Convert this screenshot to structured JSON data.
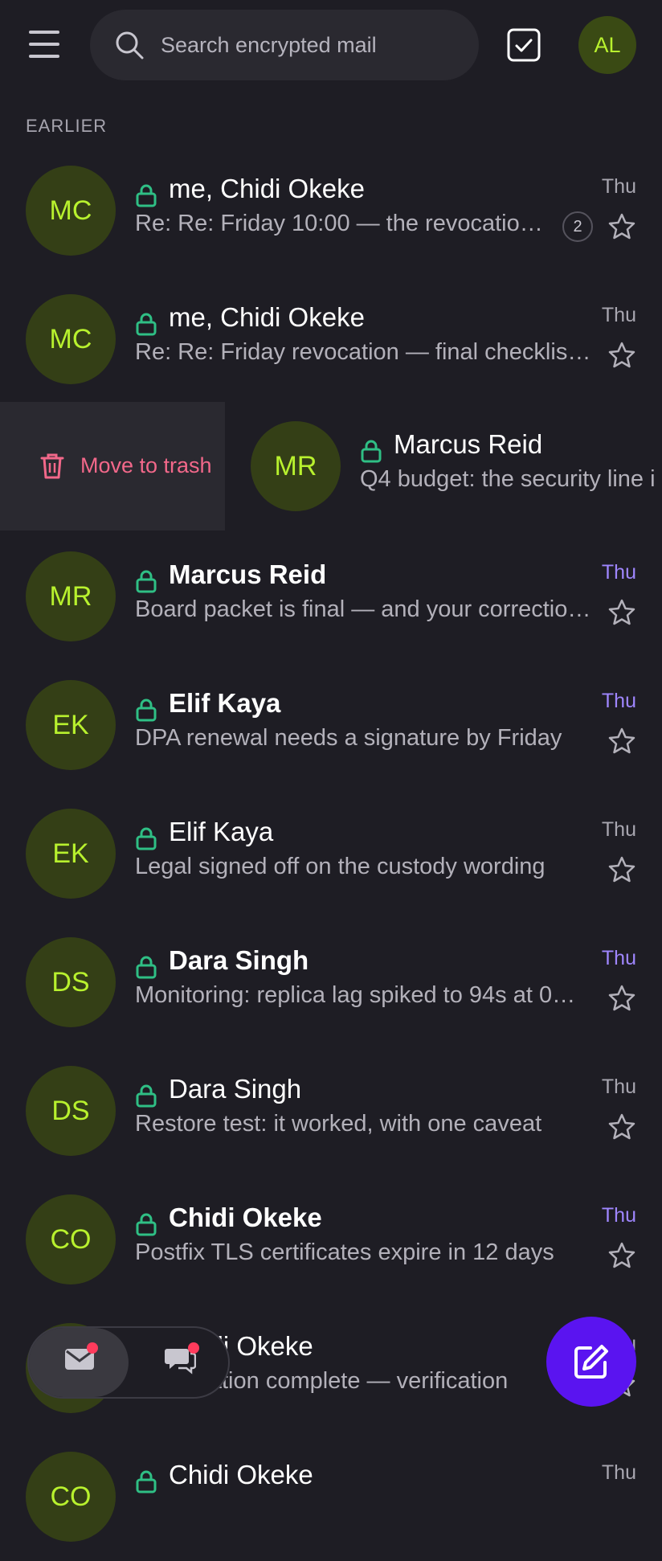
{
  "header": {
    "search_placeholder": "Search encrypted mail",
    "user_initials": "AL"
  },
  "section_label": "EARLIER",
  "swipe_action": {
    "label": "Move to trash"
  },
  "swiped_row": {
    "initials": "MR",
    "sender": "Marcus Reid",
    "preview": "Q4 budget: the security line i"
  },
  "rows": [
    {
      "initials": "MC",
      "sender": "me, Chidi Okeke",
      "preview": "Re: Re: Friday 10:00 — the revocation …",
      "date": "Thu",
      "unread": false,
      "count": "2"
    },
    {
      "initials": "MC",
      "sender": "me, Chidi Okeke",
      "preview": "Re: Re: Friday revocation — final checklist…",
      "date": "Thu",
      "unread": false
    },
    {
      "initials": "MR",
      "sender": "Marcus Reid",
      "preview": "Board packet is final — and your correctio…",
      "date": "Thu",
      "unread": true
    },
    {
      "initials": "EK",
      "sender": "Elif Kaya",
      "preview": "DPA renewal needs a signature by Friday",
      "date": "Thu",
      "unread": true
    },
    {
      "initials": "EK",
      "sender": "Elif Kaya",
      "preview": "Legal signed off on the custody wording",
      "date": "Thu",
      "unread": false
    },
    {
      "initials": "DS",
      "sender": "Dara Singh",
      "preview": "Monitoring: replica lag spiked to 94s at 0…",
      "date": "Thu",
      "unread": true
    },
    {
      "initials": "DS",
      "sender": "Dara Singh",
      "preview": "Restore test: it worked, with one caveat",
      "date": "Thu",
      "unread": false
    },
    {
      "initials": "CO",
      "sender": "Chidi Okeke",
      "preview": "Postfix TLS certificates expire in 12 days",
      "date": "Thu",
      "unread": true
    },
    {
      "initials": "CO",
      "sender": "Chidi Okeke",
      "preview": "Key rotation complete — verification",
      "date": "Thu",
      "unread": false
    },
    {
      "initials": "CO",
      "sender": "Chidi Okeke",
      "preview": "",
      "date": "Thu",
      "unread": false
    }
  ],
  "icons": {
    "menu": "menu-icon",
    "search": "search-icon",
    "select": "checkbox-icon",
    "lock": "lock-icon",
    "star": "star-icon",
    "trash": "trash-icon",
    "mail": "mail-icon",
    "chat": "chat-icon",
    "compose": "compose-icon"
  },
  "colors": {
    "background": "#1e1d24",
    "avatar_bg": "#343f16",
    "avatar_text": "#b8f12e",
    "lock": "#2fbf85",
    "unread_date": "#9f86ff",
    "trash": "#f2688a",
    "compose": "#5a14f0",
    "badge": "#ff3b5c"
  }
}
